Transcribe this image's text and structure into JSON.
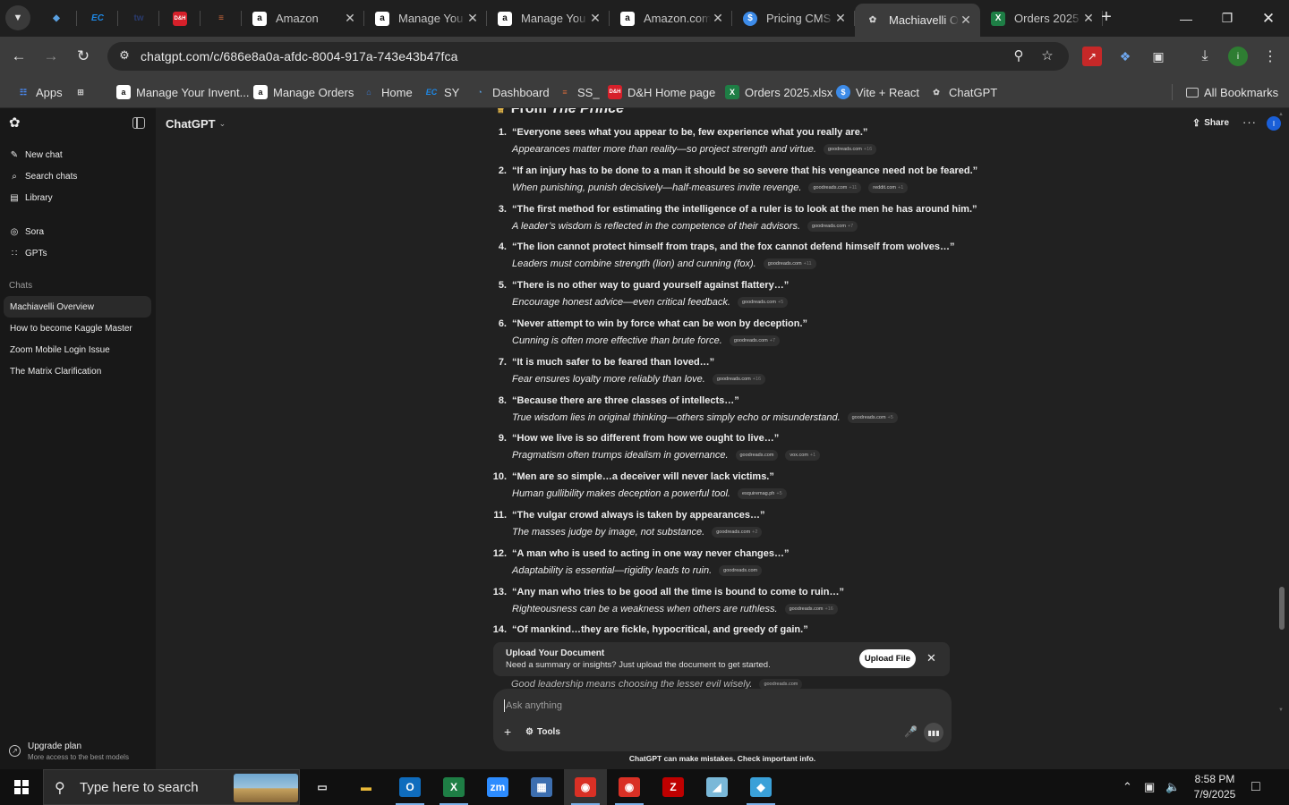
{
  "browser": {
    "tabs": [
      {
        "kind": "pinned",
        "icon": "diamond",
        "title": "",
        "color": "#5aa0e0"
      },
      {
        "kind": "pinned",
        "icon": "EC",
        "title": "",
        "color": "#1e88e5"
      },
      {
        "kind": "pinned",
        "icon": "tw",
        "title": "",
        "color": "#2a3b6e"
      },
      {
        "kind": "pinned",
        "icon": "D&H",
        "title": "",
        "color": "#d6202a"
      },
      {
        "kind": "pinned",
        "icon": "stack",
        "title": "",
        "color": "#d2693a"
      },
      {
        "kind": "normal",
        "icon": "a",
        "title": "Amazon",
        "color": "#ffffff"
      },
      {
        "kind": "normal",
        "icon": "a",
        "title": "Manage You",
        "color": "#ffffff"
      },
      {
        "kind": "normal",
        "icon": "a",
        "title": "Manage You",
        "color": "#ffffff"
      },
      {
        "kind": "normal",
        "icon": "a",
        "title": "Amazon.com",
        "color": "#ffffff"
      },
      {
        "kind": "normal",
        "icon": "$",
        "title": "Pricing CMS",
        "color": "#3d8be8"
      },
      {
        "kind": "active",
        "icon": "chatgpt",
        "title": "Machiavelli O",
        "color": "#cfcfcf"
      },
      {
        "kind": "normal",
        "icon": "x",
        "title": "Orders 2025",
        "color": "#1e7e45"
      }
    ],
    "url": "chatgpt.com/c/686e8a0a-afdc-8004-917a-743e43b47fca",
    "bookmarks": [
      {
        "label": "Apps",
        "icon": "grid",
        "color": "#4a8af4"
      },
      {
        "label": "",
        "icon": "tabgrid",
        "color": "#c8c8c8"
      },
      {
        "label": "Manage Your Invent...",
        "icon": "a",
        "color": "#ffffff"
      },
      {
        "label": "Manage Orders",
        "icon": "a",
        "color": "#ffffff"
      },
      {
        "label": "Home",
        "icon": "home",
        "color": "#3a7bd5"
      },
      {
        "label": "SY",
        "icon": "EC",
        "color": "#1e88e5"
      },
      {
        "label": "Dashboard",
        "icon": "dash",
        "color": "#5aa0e0"
      },
      {
        "label": "SS_",
        "icon": "stack",
        "color": "#d2693a"
      },
      {
        "label": "D&H Home page",
        "icon": "D&H",
        "color": "#d6202a"
      },
      {
        "label": "Orders 2025.xlsx",
        "icon": "x",
        "color": "#1e7e45"
      },
      {
        "label": "Vite + React",
        "icon": "$",
        "color": "#3d8be8"
      },
      {
        "label": "ChatGPT",
        "icon": "chatgpt",
        "color": "#cfcfcf"
      }
    ],
    "all_bookmarks": "All Bookmarks"
  },
  "sidebar": {
    "nav": [
      {
        "label": "New chat",
        "icon": "edit-icon"
      },
      {
        "label": "Search chats",
        "icon": "search-icon"
      },
      {
        "label": "Library",
        "icon": "library-icon"
      }
    ],
    "apps": [
      {
        "label": "Sora",
        "icon": "sora-icon"
      },
      {
        "label": "GPTs",
        "icon": "gpts-icon"
      }
    ],
    "chats_header": "Chats",
    "chats": [
      {
        "label": "Machiavelli Overview",
        "active": true
      },
      {
        "label": "How to become Kaggle Master",
        "active": false
      },
      {
        "label": "Zoom Mobile Login Issue",
        "active": false
      },
      {
        "label": "The Matrix Clarification",
        "active": false
      }
    ],
    "upgrade_title": "Upgrade plan",
    "upgrade_sub": "More access to the best models"
  },
  "header": {
    "model": "ChatGPT",
    "share": "Share",
    "avatar": "I"
  },
  "conversation": {
    "heading_prefix": "From ",
    "heading_italic": "The Prince",
    "quotes": [
      {
        "num": "1.",
        "quote": "“Everyone sees what you appear to be, few experience what you really are.”",
        "meaning": "Appearances matter more than reality—so project strength and virtue.",
        "sources": [
          {
            "site": "goodreads.com",
            "plus": "+16"
          }
        ]
      },
      {
        "num": "2.",
        "quote": "“If an injury has to be done to a man it should be so severe that his vengeance need not be feared.”",
        "meaning": "When punishing, punish decisively—half-measures invite revenge.",
        "sources": [
          {
            "site": "goodreads.com",
            "plus": "+11"
          },
          {
            "site": "reddit.com",
            "plus": "+1"
          }
        ]
      },
      {
        "num": "3.",
        "quote": "“The first method for estimating the intelligence of a ruler is to look at the men he has around him.”",
        "meaning": "A leader’s wisdom is reflected in the competence of their advisors.",
        "sources": [
          {
            "site": "goodreads.com",
            "plus": "+7"
          }
        ]
      },
      {
        "num": "4.",
        "quote": "“The lion cannot protect himself from traps, and the fox cannot defend himself from wolves…”",
        "meaning": "Leaders must combine strength (lion) and cunning (fox).",
        "sources": [
          {
            "site": "goodreads.com",
            "plus": "+11"
          }
        ]
      },
      {
        "num": "5.",
        "quote": "“There is no other way to guard yourself against flattery…”",
        "meaning": "Encourage honest advice—even critical feedback.",
        "sources": [
          {
            "site": "goodreads.com",
            "plus": "+5"
          }
        ]
      },
      {
        "num": "6.",
        "quote": "“Never attempt to win by force what can be won by deception.”",
        "meaning": "Cunning is often more effective than brute force.",
        "sources": [
          {
            "site": "goodreads.com",
            "plus": "+7"
          }
        ]
      },
      {
        "num": "7.",
        "quote": "“It is much safer to be feared than loved…”",
        "meaning": "Fear ensures loyalty more reliably than love.",
        "sources": [
          {
            "site": "goodreads.com",
            "plus": "+16"
          }
        ]
      },
      {
        "num": "8.",
        "quote": "“Because there are three classes of intellects…”",
        "meaning": "True wisdom lies in original thinking—others simply echo or misunderstand.",
        "sources": [
          {
            "site": "goodreads.com",
            "plus": "+5"
          }
        ]
      },
      {
        "num": "9.",
        "quote": "“How we live is so different from how we ought to live…”",
        "meaning": "Pragmatism often trumps idealism in governance.",
        "sources": [
          {
            "site": "goodreads.com",
            "plus": ""
          },
          {
            "site": "vox.com",
            "plus": "+1"
          }
        ]
      },
      {
        "num": "10.",
        "quote": "“Men are so simple…a deceiver will never lack victims.”",
        "meaning": "Human gullibility makes deception a powerful tool.",
        "sources": [
          {
            "site": "esquiremag.ph",
            "plus": "+5"
          }
        ]
      },
      {
        "num": "11.",
        "quote": "“The vulgar crowd always is taken by appearances…”",
        "meaning": "The masses judge by image, not substance.",
        "sources": [
          {
            "site": "goodreads.com",
            "plus": "+2"
          }
        ]
      },
      {
        "num": "12.",
        "quote": "“A man who is used to acting in one way never changes…”",
        "meaning": "Adaptability is essential—rigidity leads to ruin.",
        "sources": [
          {
            "site": "goodreads.com",
            "plus": ""
          }
        ]
      },
      {
        "num": "13.",
        "quote": "“Any man who tries to be good all the time is bound to come to ruin…”",
        "meaning": "Righteousness can be a weakness when others are ruthless.",
        "sources": [
          {
            "site": "goodreads.com",
            "plus": "+16"
          }
        ]
      },
      {
        "num": "14.",
        "quote": "“Of mankind…they are fickle, hypocritical, and greedy of gain.”",
        "meaning": "",
        "sources": []
      }
    ],
    "cutoff_line": "Good leadership means choosing the lesser evil wisely.",
    "cutoff_source": "goodreads.com"
  },
  "upload_banner": {
    "title": "Upload Your Document",
    "subtitle": "Need a summary or insights? Just upload the document to get started.",
    "button": "Upload File"
  },
  "composer": {
    "placeholder": "Ask anything",
    "tools": "Tools"
  },
  "disclaimer": "ChatGPT can make mistakes. Check important info.",
  "taskbar": {
    "search_placeholder": "Type here to search",
    "apps": [
      {
        "name": "task-view",
        "glyph": "▭",
        "color": "transparent",
        "running": false
      },
      {
        "name": "file-explorer",
        "glyph": "▬",
        "color": "#e8b838",
        "running": false
      },
      {
        "name": "outlook",
        "glyph": "O",
        "color": "#0f6cbd",
        "running": true
      },
      {
        "name": "excel",
        "glyph": "X",
        "color": "#1e7e45",
        "running": true
      },
      {
        "name": "zoom",
        "glyph": "zm",
        "color": "#2d8cff",
        "running": false
      },
      {
        "name": "calculator",
        "glyph": "▦",
        "color": "#3d6fb0",
        "running": false
      },
      {
        "name": "chrome",
        "glyph": "◉",
        "color": "#d93025",
        "running": true
      },
      {
        "name": "chrome-2",
        "glyph": "◉",
        "color": "#d93025",
        "running": true
      },
      {
        "name": "filezilla",
        "glyph": "Z",
        "color": "#bf0000",
        "running": false
      },
      {
        "name": "notepad",
        "glyph": "◢",
        "color": "#7ab8d8",
        "running": false
      },
      {
        "name": "app-diamond",
        "glyph": "◆",
        "color": "#3aa0d8",
        "running": true
      }
    ],
    "time": "8:58 PM",
    "date": "7/9/2025"
  }
}
